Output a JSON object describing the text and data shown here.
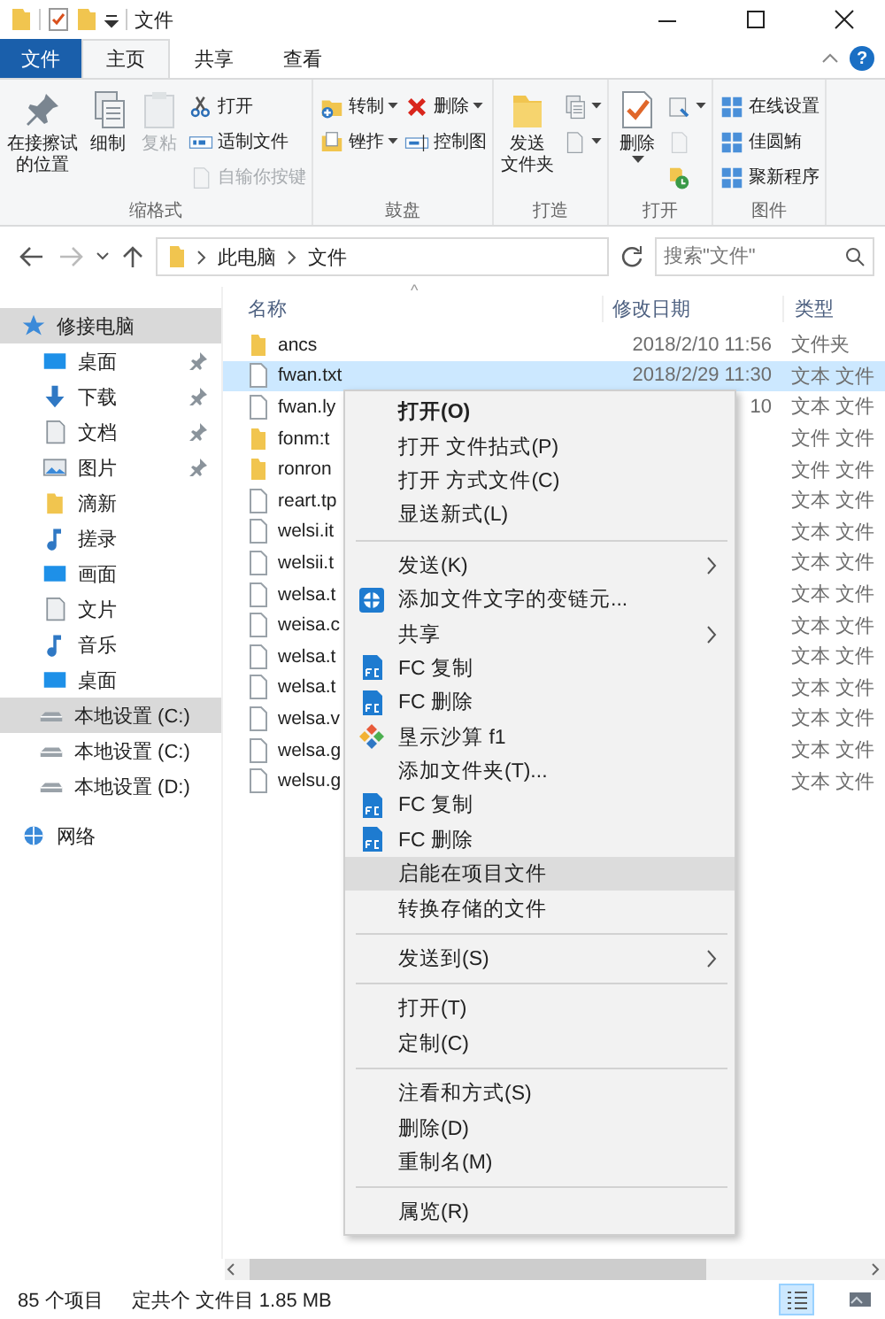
{
  "window": {
    "title": "文件"
  },
  "tabs": [
    {
      "label": "文件",
      "kind": "file",
      "selected": false
    },
    {
      "label": "主页",
      "kind": "tab",
      "selected": true
    },
    {
      "label": "共享",
      "kind": "tab",
      "selected": false
    },
    {
      "label": "查看",
      "kind": "tab",
      "selected": false
    }
  ],
  "help": "?",
  "ribbon": [
    {
      "label": "缩格式",
      "columns": [
        [
          {
            "kind": "big",
            "lines": [
              "在接擦试",
              "的位置"
            ],
            "disabled": false,
            "caret": false
          }
        ],
        [
          {
            "kind": "big",
            "lines": [
              "细制"
            ],
            "disabled": false,
            "caret": false
          }
        ],
        [
          {
            "kind": "big",
            "lines": [
              "复粘"
            ],
            "disabled": true,
            "caret": false
          }
        ],
        [
          {
            "kind": "small",
            "label": "打开",
            "disabled": false,
            "caret": false
          },
          {
            "kind": "small",
            "label": "适制文件",
            "disabled": false,
            "caret": false
          },
          {
            "kind": "small",
            "label": "自输你按键",
            "disabled": true,
            "caret": false
          }
        ]
      ]
    },
    {
      "label": "鼓盘",
      "columns": [
        [
          {
            "kind": "small",
            "label": "转制",
            "disabled": false,
            "caret": true
          },
          {
            "kind": "small",
            "label": "锉拃",
            "disabled": false,
            "caret": true
          }
        ],
        [
          {
            "kind": "small",
            "label": "删除",
            "disabled": false,
            "caret": true
          },
          {
            "kind": "small",
            "label": "控制图",
            "disabled": false,
            "caret": false
          }
        ]
      ]
    },
    {
      "label": "打造",
      "columns": [
        [
          {
            "kind": "big",
            "lines": [
              "发送",
              "文件夹"
            ],
            "disabled": false,
            "caret": false
          }
        ],
        [
          {
            "kind": "small",
            "disabled": false,
            "caret": true
          },
          {
            "kind": "small",
            "disabled": false,
            "caret": true
          }
        ]
      ]
    },
    {
      "label": "打开",
      "columns": [
        [
          {
            "kind": "big",
            "lines": [
              "删除"
            ],
            "disabled": false,
            "caret": true
          }
        ],
        [
          {
            "kind": "small",
            "disabled": false,
            "caret": true
          },
          {
            "kind": "small",
            "disabled": true,
            "caret": false
          },
          {
            "kind": "small",
            "disabled": false,
            "caret": false
          }
        ]
      ]
    },
    {
      "label": "图件",
      "columns": [
        [
          {
            "kind": "small",
            "label": "在线设置",
            "disabled": false,
            "caret": false
          },
          {
            "kind": "small",
            "label": "佳圆鮪",
            "disabled": false,
            "caret": false
          },
          {
            "kind": "small",
            "label": "聚新程序",
            "disabled": false,
            "caret": false
          }
        ]
      ]
    }
  ],
  "address": {
    "crumbs": [
      "此电脑",
      "文件"
    ]
  },
  "search": {
    "placeholder": "搜索\"文件\""
  },
  "sidebar": {
    "items": [
      {
        "label": "修接电脑",
        "pinned": false,
        "selected": true
      },
      {
        "label": "桌面",
        "pinned": true,
        "selected": false
      },
      {
        "label": "下载",
        "pinned": true,
        "selected": false
      },
      {
        "label": "文档",
        "pinned": true,
        "selected": false
      },
      {
        "label": "图片",
        "pinned": true,
        "selected": false
      },
      {
        "label": "滴新",
        "pinned": false,
        "selected": false
      },
      {
        "label": "搓录",
        "pinned": false,
        "selected": false
      },
      {
        "label": "画面",
        "pinned": false,
        "selected": false
      },
      {
        "label": "文片",
        "pinned": false,
        "selected": false
      },
      {
        "label": "音乐",
        "pinned": false,
        "selected": false
      },
      {
        "label": "桌面",
        "pinned": false,
        "selected": false
      },
      {
        "label": "本地设置 (C:)",
        "pinned": false,
        "selected": true
      },
      {
        "label": "本地设置 (C:)",
        "pinned": false,
        "selected": false
      },
      {
        "label": "本地设置 (D:)",
        "pinned": false,
        "selected": false
      },
      {
        "label": "网络",
        "pinned": false,
        "selected": false
      }
    ]
  },
  "table": {
    "sort_mark": "^",
    "columns": [
      "名称",
      "修改日期",
      "类型"
    ],
    "rows": [
      {
        "kind": "folder",
        "name": "ancs",
        "date": "2018/2/10 11:56",
        "type": "文件夹",
        "selected": false
      },
      {
        "kind": "file",
        "name": "fwan.txt",
        "date": "2018/2/29 11:30",
        "type": "文本 文件",
        "selected": true
      },
      {
        "kind": "file",
        "name": "fwan.ly",
        "date": "10",
        "type": "文本 文件",
        "selected": false
      },
      {
        "kind": "folder",
        "name": "fonm:t",
        "type": "文件 文件",
        "selected": false
      },
      {
        "kind": "folder",
        "name": "ronron",
        "type": "文件 文件",
        "selected": false
      },
      {
        "kind": "file",
        "name": "reart.tp",
        "type": "文本 文件",
        "selected": false
      },
      {
        "kind": "file",
        "name": "welsi.it",
        "type": "文本 文件",
        "selected": false
      },
      {
        "kind": "file",
        "name": "welsii.t",
        "type": "文本 文件",
        "selected": false
      },
      {
        "kind": "file",
        "name": "welsa.t",
        "type": "文本 文件",
        "selected": false
      },
      {
        "kind": "file",
        "name": "weisa.c",
        "type": "文本 文件",
        "selected": false
      },
      {
        "kind": "file",
        "name": "welsa.t",
        "type": "文本 文件",
        "selected": false
      },
      {
        "kind": "file",
        "name": "welsa.t",
        "type": "文本 文件",
        "selected": false
      },
      {
        "kind": "file",
        "name": "welsa.v",
        "type": "文本 文件",
        "selected": false
      },
      {
        "kind": "file",
        "name": "welsa.g",
        "type": "文本 文件",
        "selected": false
      },
      {
        "kind": "file",
        "name": "welsu.g",
        "type": "文本 文件",
        "selected": false
      }
    ]
  },
  "context_menu": {
    "items": [
      {
        "kind": "item",
        "label": "打开(O)",
        "bold": true,
        "submenu": false,
        "selected": false
      },
      {
        "kind": "item",
        "label": "打开 文件拈式(P)",
        "bold": false,
        "submenu": false,
        "selected": false
      },
      {
        "kind": "item",
        "label": "打开 方式文件(C)",
        "bold": false,
        "submenu": false,
        "selected": false
      },
      {
        "kind": "item",
        "label": "显送新式(L)",
        "bold": false,
        "submenu": false,
        "selected": false
      },
      {
        "kind": "separator"
      },
      {
        "kind": "item",
        "label": "发送(K)",
        "bold": false,
        "submenu": true,
        "selected": false
      },
      {
        "kind": "item",
        "label": "添加文件文字的变链元...",
        "bold": false,
        "submenu": false,
        "selected": false
      },
      {
        "kind": "item",
        "label": "共享",
        "bold": false,
        "submenu": true,
        "selected": false
      },
      {
        "kind": "item",
        "label": "FC 复制",
        "bold": false,
        "submenu": false,
        "selected": false
      },
      {
        "kind": "item",
        "label": "FC 删除",
        "bold": false,
        "submenu": false,
        "selected": false
      },
      {
        "kind": "item",
        "label": "垦示沙算 f1",
        "bold": false,
        "submenu": false,
        "selected": false
      },
      {
        "kind": "item",
        "label": "添加文件夹(T)...",
        "bold": false,
        "submenu": false,
        "selected": false
      },
      {
        "kind": "item",
        "label": "FC 复制",
        "bold": false,
        "submenu": false,
        "selected": false
      },
      {
        "kind": "item",
        "label": "FC 删除",
        "bold": false,
        "submenu": false,
        "selected": false
      },
      {
        "kind": "item",
        "label": "启能在项目文件",
        "bold": false,
        "submenu": false,
        "selected": true
      },
      {
        "kind": "item",
        "label": "转换存储的文件",
        "bold": false,
        "submenu": false,
        "selected": false
      },
      {
        "kind": "separator"
      },
      {
        "kind": "item",
        "label": "发送到(S)",
        "bold": false,
        "submenu": true,
        "selected": false
      },
      {
        "kind": "separator"
      },
      {
        "kind": "item",
        "label": "打开(T)",
        "bold": false,
        "submenu": false,
        "selected": false
      },
      {
        "kind": "item",
        "label": "定制(C)",
        "bold": false,
        "submenu": false,
        "selected": false
      },
      {
        "kind": "separator"
      },
      {
        "kind": "item",
        "label": "注看和方式(S)",
        "bold": false,
        "submenu": false,
        "selected": false
      },
      {
        "kind": "item",
        "label": "删除(D)",
        "bold": false,
        "submenu": false,
        "selected": false
      },
      {
        "kind": "item",
        "label": "重制名(M)",
        "bold": false,
        "submenu": false,
        "selected": false
      },
      {
        "kind": "separator"
      },
      {
        "kind": "item",
        "label": "属览(R)",
        "bold": false,
        "submenu": false,
        "selected": false
      }
    ]
  },
  "status_bar": {
    "count": "85 个项目",
    "selection": "定共个 文件目 1.85 MB",
    "views": [
      {
        "kind": "details",
        "selected": true
      },
      {
        "kind": "tiles",
        "selected": false
      }
    ]
  }
}
